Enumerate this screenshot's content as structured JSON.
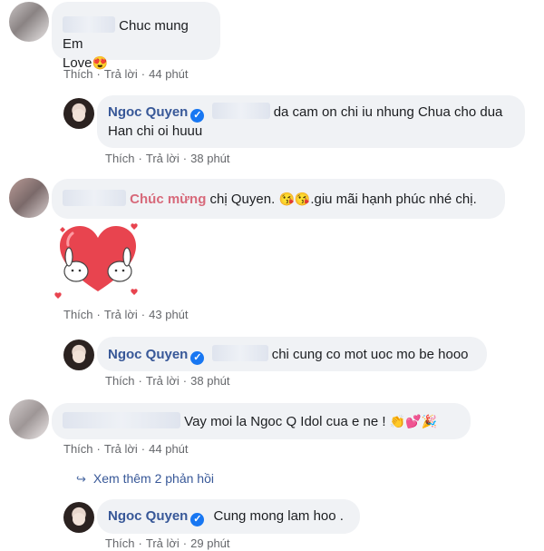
{
  "comments": [
    {
      "text_lines": [
        "Chuc mung Em",
        "Love"
      ],
      "emoji": "😍",
      "actions": {
        "like": "Thích",
        "reply": "Trả lời",
        "time": "44 phút"
      }
    },
    {
      "author": "Ngoc Quyen",
      "text_lines": [
        "da cam on chi iu nhung Chua cho dua",
        "Han chi oi huuu"
      ],
      "actions": {
        "like": "Thích",
        "reply": "Trả lời",
        "time": "38 phút"
      }
    },
    {
      "highlight": "Chúc mừng",
      "text_a": "chị Quyen.",
      "emoji": "😘😘",
      "text_b": ".giu mãi hạnh phúc nhé chị.",
      "actions": {
        "like": "Thích",
        "reply": "Trả lời",
        "time": "43 phút"
      }
    },
    {
      "author": "Ngoc Quyen",
      "text": "chi cung co mot uoc mo be hooo",
      "actions": {
        "like": "Thích",
        "reply": "Trả lời",
        "time": "38 phút"
      }
    },
    {
      "text": "Vay moi la Ngoc Q Idol cua e ne !",
      "emoji": "👏💕🎉",
      "actions": {
        "like": "Thích",
        "reply": "Trả lời",
        "time": "44 phút"
      }
    },
    {
      "author": "Ngoc Quyen",
      "text": "Cung mong lam hoo .",
      "actions": {
        "like": "Thích",
        "reply": "Trả lời",
        "time": "29 phút"
      }
    }
  ],
  "view_more": "Xem thêm 2 phản hồi",
  "icons": {
    "verified": "verified-badge-icon",
    "reply_arrow": "reply-arrow-icon"
  },
  "colors": {
    "name": "#385898",
    "bubble": "#f0f2f5",
    "meta": "#65676b",
    "highlight": "#d7697a"
  }
}
